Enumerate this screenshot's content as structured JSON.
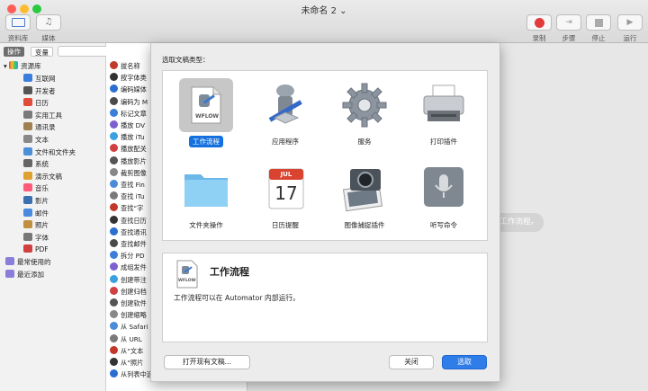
{
  "window": {
    "title": "未命名 2"
  },
  "toolbar": {
    "library_label": "资料库",
    "media_label": "媒体",
    "record_label": "录制",
    "step_label": "步骤",
    "stop_label": "停止",
    "run_label": "运行"
  },
  "left_panel": {
    "tab_actions": "操作",
    "tab_variables": "变量",
    "search_placeholder": "名",
    "library_root": "资源库",
    "categories": [
      "互联网",
      "开发者",
      "日历",
      "实用工具",
      "通讯录",
      "文本",
      "文件和文件夹",
      "系统",
      "演示文稿",
      "音乐",
      "影片",
      "邮件",
      "照片",
      "字体",
      "PDF"
    ],
    "most_used": "最常使用的",
    "recently_added": "最近添加"
  },
  "actions": [
    "拔名称",
    "按字体类",
    "编码媒体",
    "编码为 M",
    "标记文章",
    "播放 DV",
    "播放 iTu",
    "播放配关",
    "播放影片",
    "裁剪图像",
    "查找 Fin",
    "查找 iTu",
    "查找“字",
    "查找日历",
    "查找通讯",
    "查找邮件",
    "拆分 PD",
    "成组发件",
    "创建带注",
    "创建归档",
    "创建软件",
    "创建缩略",
    "从 Safari",
    "从 URL",
    "从“文本",
    "从“照片",
    "从列表中选取"
  ],
  "sheet": {
    "heading": "选取文稿类型：",
    "types": [
      {
        "label": "工作流程",
        "icon": "workflow-icon",
        "selected": true
      },
      {
        "label": "应用程序",
        "icon": "automator-robot-icon",
        "selected": false
      },
      {
        "label": "服务",
        "icon": "gear-icon",
        "selected": false
      },
      {
        "label": "打印插件",
        "icon": "printer-icon",
        "selected": false
      },
      {
        "label": "文件夹操作",
        "icon": "folder-icon",
        "selected": false
      },
      {
        "label": "日历提醒",
        "icon": "calendar-icon",
        "selected": false
      },
      {
        "label": "图像捕捉插件",
        "icon": "image-capture-icon",
        "selected": false
      },
      {
        "label": "听写命令",
        "icon": "microphone-icon",
        "selected": false
      }
    ],
    "workflow_badge": "WFLOW",
    "calendar_month": "JUL",
    "calendar_day": "17",
    "description_title": "工作流程",
    "description_text": "工作流程可以在 Automator 内部运行。",
    "open_existing_label": "打开现有文稿...",
    "close_label": "关闭",
    "choose_label": "选取"
  },
  "canvas_hint": "工作流程。",
  "colors": {
    "accent": "#1470de",
    "record": "#e23b3b",
    "folder": "#7fc6f0"
  }
}
